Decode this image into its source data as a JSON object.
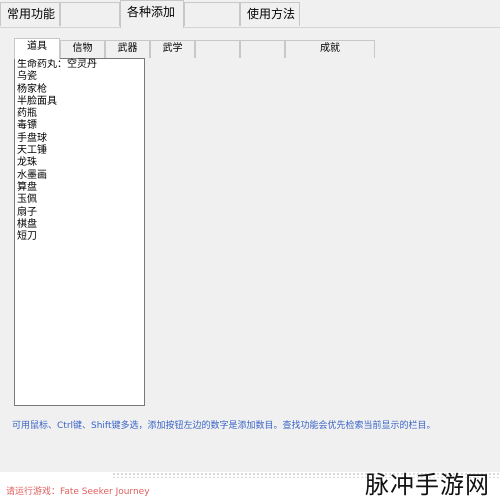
{
  "top_tabs": [
    "常用功能",
    "",
    "各种添加",
    "",
    "使用方法"
  ],
  "sub_tabs": [
    "道具",
    "信物",
    "武器",
    "武学",
    "",
    "",
    "成就"
  ],
  "list_items": [
    "生命药丸：空灵丹",
    "乌瓷",
    "杨家枪",
    "半脸面具",
    "药瓶",
    "毒镖",
    "手盘球",
    "天工锤",
    "龙珠",
    "水墨画",
    "算盘",
    "玉佩",
    "扇子",
    "棋盘",
    "短刀"
  ],
  "hint": "可用鼠标、Ctrl键、Shift键多选，添加按钮左边的数字是添加数目。查找功能会优先检索当前显示的栏目。",
  "footer": "请运行游戏：Fate Seeker Journey",
  "watermark": "脉冲手游网",
  "colors": {
    "hint": "#3a64c8",
    "footer": "#e06060",
    "background": "#f0f0f0"
  }
}
